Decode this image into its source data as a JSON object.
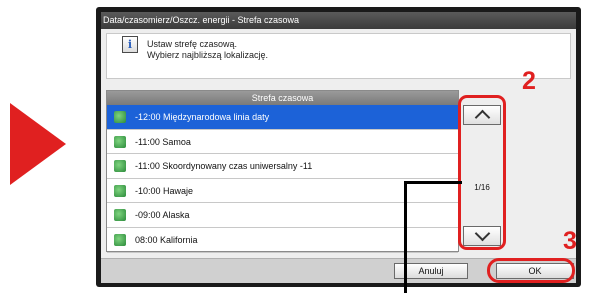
{
  "window": {
    "title": "Data/czasomierz/Oszcz. energii - Strefa czasowa"
  },
  "message": {
    "line1": "Ustaw strefę czasową.",
    "line2": "Wybierz najbliższą lokalizację."
  },
  "list": {
    "header": "Strefa czasowa",
    "items": [
      {
        "label": "-12:00 Międzynarodowa linia daty",
        "selected": true
      },
      {
        "label": "-11:00 Samoa",
        "selected": false
      },
      {
        "label": "-11:00 Skoordynowany czas uniwersalny -11",
        "selected": false
      },
      {
        "label": "-10:00 Hawaje",
        "selected": false
      },
      {
        "label": "-09:00 Alaska",
        "selected": false
      },
      {
        "label": "08:00 Kalifornia",
        "selected": false
      }
    ],
    "page_indicator": "1/16"
  },
  "buttons": {
    "cancel": "Anuluj",
    "ok": "OK"
  },
  "annotations": {
    "step2": "2",
    "step3": "3"
  },
  "colors": {
    "accent_red": "#e02020",
    "selection_blue": "#1c62d8"
  },
  "icons": {
    "info": "info-icon",
    "timezone_globe": "globe-icon",
    "scroll_up": "chevron-up-icon",
    "scroll_down": "chevron-down-icon",
    "step_arrow": "play-arrow-icon"
  }
}
